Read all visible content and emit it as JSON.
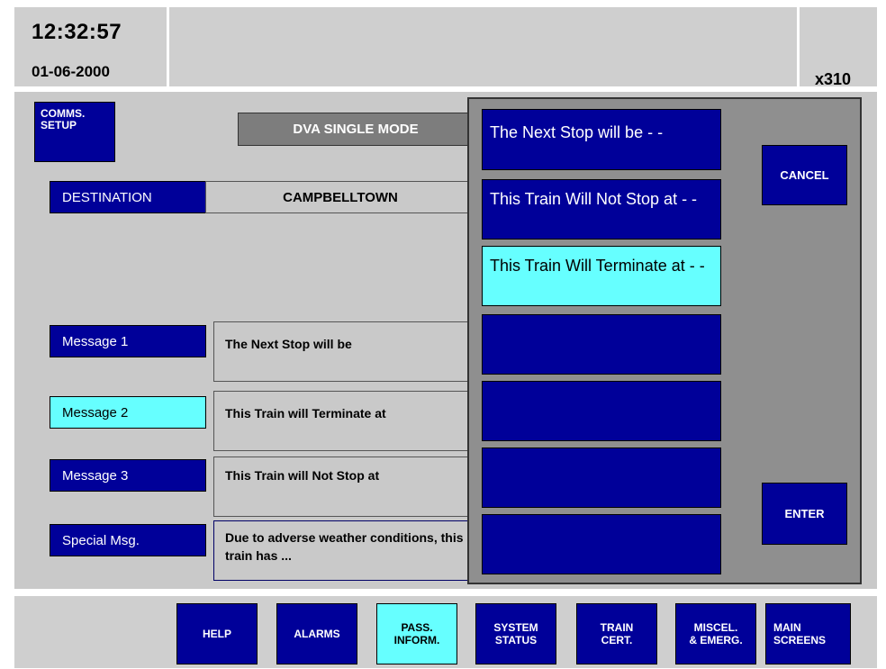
{
  "header": {
    "time": "12:32:57",
    "date": "01-06-2000",
    "unit_id": "x310"
  },
  "main": {
    "comms_setup_label": [
      "COMMS.",
      "SETUP"
    ],
    "mode_label": "DVA SINGLE MODE",
    "destination": {
      "label": "DESTINATION",
      "value": "CAMPBELLTOWN"
    },
    "messages": [
      {
        "label": "Message  1",
        "text": "The Next Stop will be",
        "selected": false
      },
      {
        "label": "Message  2",
        "text": "This Train will Terminate at",
        "selected": true
      },
      {
        "label": "Message  3",
        "text": "This Train will Not Stop at",
        "selected": false
      },
      {
        "label": "Special Msg.",
        "text": "Due to adverse weather conditions, this train has ...",
        "selected": false
      }
    ]
  },
  "popup": {
    "options": [
      {
        "text": "The Next Stop will be - -",
        "selected": false
      },
      {
        "text": "This Train Will Not Stop at - -",
        "selected": false
      },
      {
        "text": "This Train Will Terminate at - -",
        "selected": true
      },
      {
        "text": "",
        "selected": false
      },
      {
        "text": "",
        "selected": false
      },
      {
        "text": "",
        "selected": false
      },
      {
        "text": "",
        "selected": false
      }
    ],
    "cancel_label": "CANCEL",
    "enter_label": "ENTER"
  },
  "footer": {
    "buttons": [
      {
        "label": "HELP",
        "active": false
      },
      {
        "label": "ALARMS",
        "active": false
      },
      {
        "label": "PASS. INFORM.",
        "active": true
      },
      {
        "label": "SYSTEM STATUS",
        "active": false
      },
      {
        "label": "TRAIN CERT.",
        "active": false
      },
      {
        "label": "MISCEL. & EMERG.",
        "active": false
      },
      {
        "label": "MAIN SCREENS",
        "active": false
      }
    ]
  },
  "colors": {
    "navy": "#000099",
    "cyan": "#66ffff",
    "panel_grey": "#c9c9c9",
    "popup_grey": "#8f8f8f",
    "mode_grey": "#7d7d7d"
  }
}
